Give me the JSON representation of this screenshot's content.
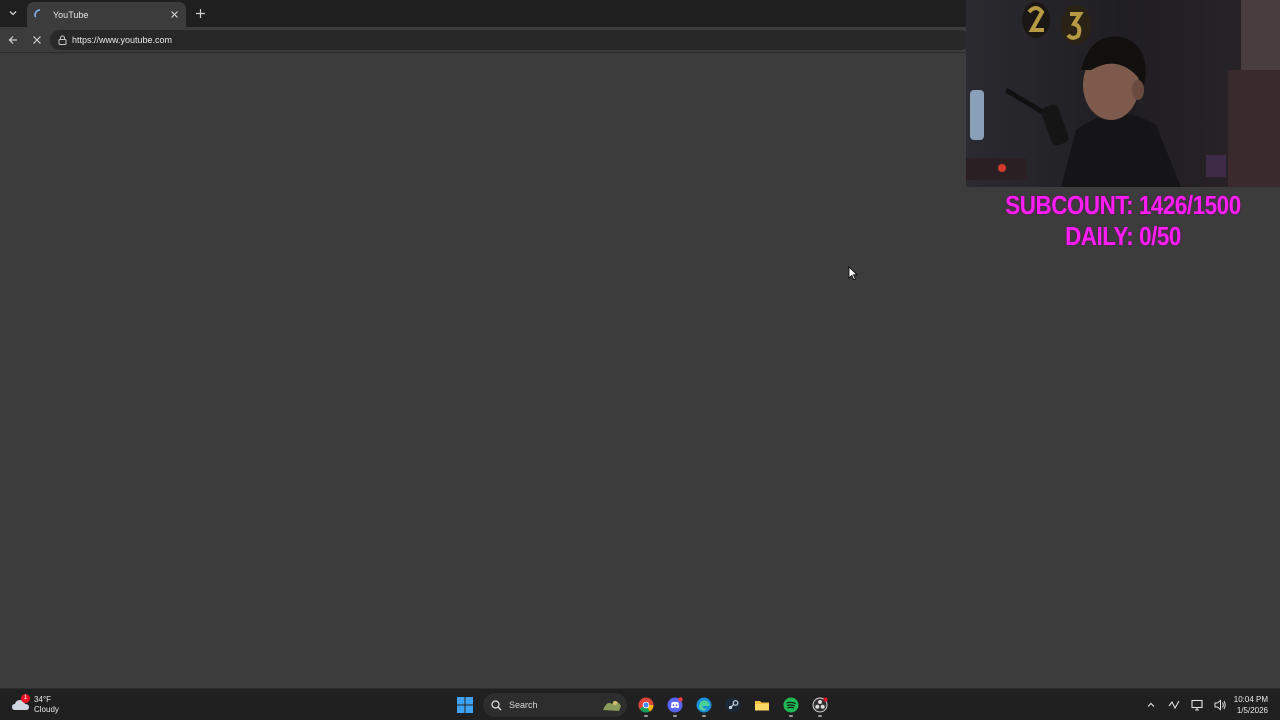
{
  "browser": {
    "tab": {
      "title": "YouTube"
    },
    "omnibox": {
      "url": "https://www.youtube.com"
    }
  },
  "overlay": {
    "subcount_line1": "SUBCOUNT: 1426/1500",
    "subcount_line2": "DAILY: 0/50",
    "text_color": "#ff1ff4"
  },
  "taskbar": {
    "weather": {
      "temperature": "34°F",
      "condition": "Cloudy",
      "badge": "1"
    },
    "search_label": "Search",
    "apps": [
      "windows-start-icon",
      "chrome-icon",
      "discord-icon",
      "edge-icon",
      "steam-icon",
      "file-explorer-icon",
      "spotify-icon",
      "obs-icon"
    ],
    "clock": {
      "time": "10:04 PM",
      "date": "1/5/2026"
    }
  },
  "colors": {
    "page_bg": "#3c3c3c",
    "tabstrip_bg": "#1f1f1f",
    "taskbar_bg": "#202020"
  }
}
